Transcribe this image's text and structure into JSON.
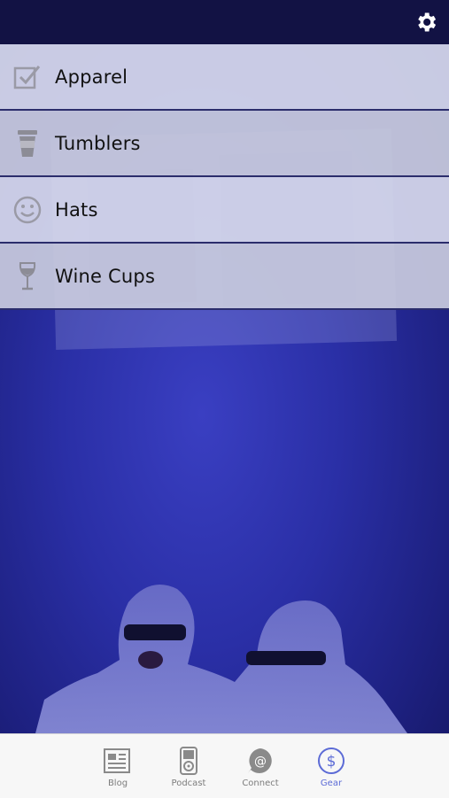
{
  "header": {
    "settings_icon": "gear-icon"
  },
  "menu": {
    "items": [
      {
        "label": "Apparel",
        "icon": "checkbox-icon"
      },
      {
        "label": "Tumblers",
        "icon": "cup-icon"
      },
      {
        "label": "Hats",
        "icon": "smiley-icon"
      },
      {
        "label": "Wine Cups",
        "icon": "wine-glass-icon"
      }
    ]
  },
  "tabbar": {
    "tabs": [
      {
        "label": "Blog",
        "icon": "newspaper-icon"
      },
      {
        "label": "Podcast",
        "icon": "ipod-icon"
      },
      {
        "label": "Connect",
        "icon": "at-sign-icon"
      },
      {
        "label": "Gear",
        "icon": "dollar-icon",
        "active": true
      }
    ]
  },
  "colors": {
    "topbar": "#121244",
    "accent": "#5c6bd6",
    "bg": "#2a2fa6"
  }
}
